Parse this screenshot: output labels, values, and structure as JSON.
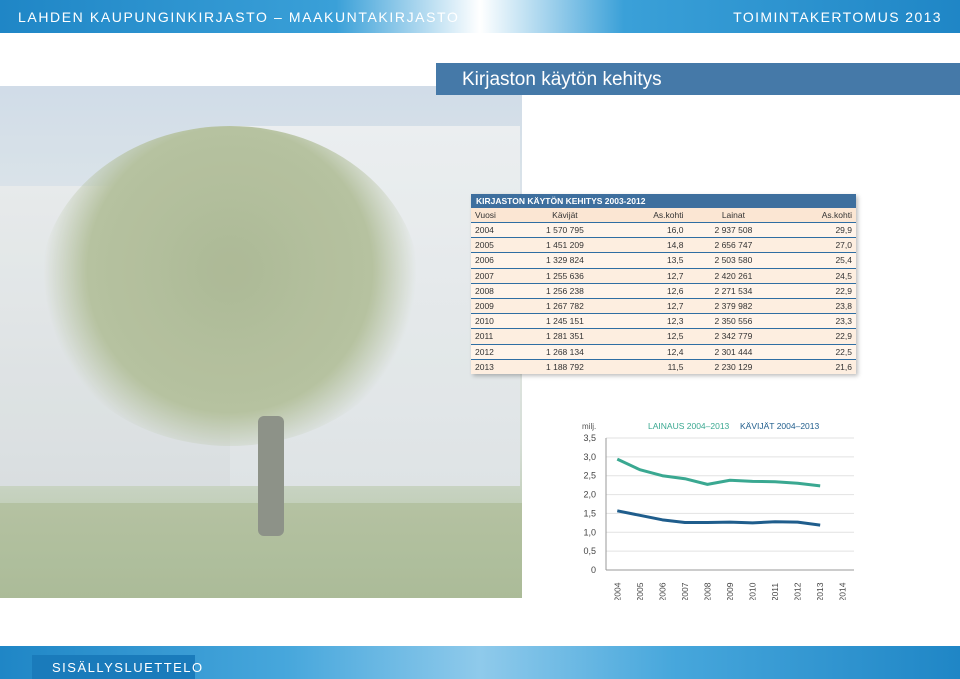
{
  "header": {
    "left": "LAHDEN KAUPUNGINKIRJASTO – MAAKUNTAKIRJASTO",
    "right": "TOIMINTAKERTOMUS 2013"
  },
  "page_title": "Kirjaston käytön kehitys",
  "table": {
    "title": "KIRJASTON KÄYTÖN KEHITYS 2003-2012",
    "headers": [
      "Vuosi",
      "Kävijät",
      "As.kohti",
      "Lainat",
      "As.kohti"
    ],
    "rows": [
      [
        "2004",
        "1 570 795",
        "16,0",
        "2 937 508",
        "29,9"
      ],
      [
        "2005",
        "1 451 209",
        "14,8",
        "2 656 747",
        "27,0"
      ],
      [
        "2006",
        "1 329 824",
        "13,5",
        "2 503 580",
        "25,4"
      ],
      [
        "2007",
        "1 255 636",
        "12,7",
        "2 420 261",
        "24,5"
      ],
      [
        "2008",
        "1 256 238",
        "12,6",
        "2 271 534",
        "22,9"
      ],
      [
        "2009",
        "1 267 782",
        "12,7",
        "2 379 982",
        "23,8"
      ],
      [
        "2010",
        "1 245 151",
        "12,3",
        "2 350 556",
        "23,3"
      ],
      [
        "2011",
        "1 281 351",
        "12,5",
        "2 342 779",
        "22,9"
      ],
      [
        "2012",
        "1 268 134",
        "12,4",
        "2 301 444",
        "22,5"
      ],
      [
        "2013",
        "1 188 792",
        "11,5",
        "2 230 129",
        "21,6"
      ]
    ]
  },
  "chart_data": {
    "type": "line",
    "unit_label": "milj.",
    "x": [
      "2004",
      "2005",
      "2006",
      "2007",
      "2008",
      "2009",
      "2010",
      "2011",
      "2012",
      "2013",
      "2014"
    ],
    "yticks": [
      "0",
      "0,5",
      "1,0",
      "1,5",
      "2,0",
      "2,5",
      "3,0",
      "3,5"
    ],
    "ylim": [
      0,
      3.5
    ],
    "series": [
      {
        "name": "LAINAUS 2004–2013",
        "color": "#3aa891",
        "values": [
          2.94,
          2.66,
          2.5,
          2.42,
          2.27,
          2.38,
          2.35,
          2.34,
          2.3,
          2.23
        ]
      },
      {
        "name": "KÄVIJÄT 2004–2013",
        "color": "#1f5d8c",
        "values": [
          1.57,
          1.45,
          1.33,
          1.26,
          1.26,
          1.27,
          1.25,
          1.28,
          1.27,
          1.19
        ]
      }
    ]
  },
  "footer": {
    "toc_label": "SISÄLLYSLUETTELO"
  }
}
